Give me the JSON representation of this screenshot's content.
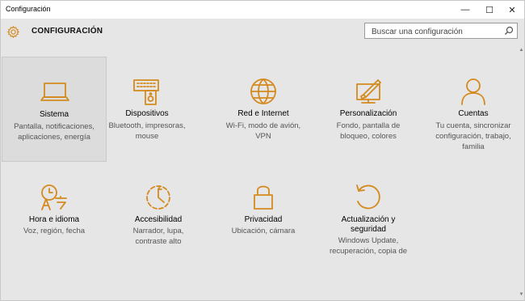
{
  "window": {
    "title": "Configuración",
    "minimize_glyph": "—",
    "maximize_glyph": "☐",
    "close_glyph": "✕"
  },
  "header": {
    "title": "CONFIGURACIÓN",
    "icon": "gear-icon",
    "search_placeholder": "Buscar una configuración"
  },
  "accent_color": "#d48a1e",
  "tiles": [
    {
      "label": "Sistema",
      "desc": [
        "Pantalla, notificaciones,",
        "aplicaciones, energía"
      ],
      "icon": "laptop-icon",
      "selected": true
    },
    {
      "label": "Dispositivos",
      "desc": [
        "Bluetooth, impresoras,",
        "mouse"
      ],
      "icon": "keyboard-speaker-icon"
    },
    {
      "label": "Red e Internet",
      "desc": [
        "Wi-Fi, modo de avión,",
        "VPN"
      ],
      "icon": "globe-icon"
    },
    {
      "label": "Personalización",
      "desc": [
        "Fondo, pantalla de",
        "bloqueo, colores"
      ],
      "icon": "paint-icon"
    },
    {
      "label": "Cuentas",
      "desc": [
        "Tu cuenta, sincronizar",
        "configuración, trabajo,",
        "familia"
      ],
      "icon": "person-icon"
    },
    {
      "label": "Hora e idioma",
      "desc": [
        "Voz, región, fecha"
      ],
      "icon": "time-language-icon"
    },
    {
      "label": "Accesibilidad",
      "desc": [
        "Narrador, lupa,",
        "contraste alto"
      ],
      "icon": "accessibility-icon"
    },
    {
      "label": "Privacidad",
      "desc": [
        "Ubicación, cámara"
      ],
      "icon": "lock-icon"
    },
    {
      "label": "Actualización y seguridad",
      "label_lines": [
        "Actualización y",
        "seguridad"
      ],
      "desc": [
        "Windows Update,",
        "recuperación, copia de"
      ],
      "icon": "update-icon"
    }
  ]
}
